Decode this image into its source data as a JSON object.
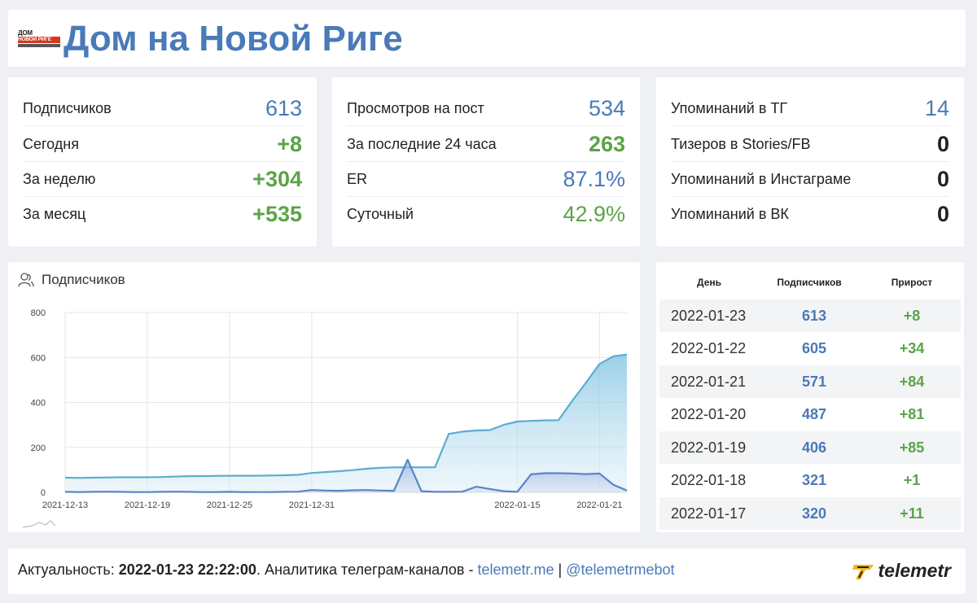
{
  "header": {
    "title": "Дом на Новой Риге",
    "logo_line1": "ДОМ",
    "logo_line2": "НОВОЙ РИГЕ"
  },
  "cards": {
    "subscribers": [
      {
        "label": "Подписчиков",
        "value": "613"
      },
      {
        "label": "Сегодня",
        "value": "+8"
      },
      {
        "label": "За неделю",
        "value": "+304"
      },
      {
        "label": "За месяц",
        "value": "+535"
      }
    ],
    "views": [
      {
        "label": "Просмотров на пост",
        "value": "534"
      },
      {
        "label": "За последние 24 часа",
        "value": "263"
      },
      {
        "label": "ER",
        "value": "87.1%"
      },
      {
        "label": "Суточный",
        "value": "42.9%"
      }
    ],
    "mentions": [
      {
        "label": "Упоминаний в ТГ",
        "value": "14"
      },
      {
        "label": "Тизеров в Stories/FB",
        "value": "0"
      },
      {
        "label": "Упоминаний в Инстаграме",
        "value": "0"
      },
      {
        "label": "Упоминаний в ВК",
        "value": "0"
      }
    ]
  },
  "chart_panel": {
    "title": "Подписчиков",
    "icon": "users-icon"
  },
  "chart_data": {
    "type": "area",
    "x": [
      "2021-12-13",
      "2021-12-14",
      "2021-12-15",
      "2021-12-16",
      "2021-12-17",
      "2021-12-18",
      "2021-12-19",
      "2021-12-20",
      "2021-12-21",
      "2021-12-22",
      "2021-12-23",
      "2021-12-24",
      "2021-12-25",
      "2021-12-26",
      "2021-12-27",
      "2021-12-28",
      "2021-12-29",
      "2021-12-30",
      "2021-12-31",
      "2022-01-01",
      "2022-01-02",
      "2022-01-03",
      "2022-01-04",
      "2022-01-05",
      "2022-01-06",
      "2022-01-07",
      "2022-01-08",
      "2022-01-09",
      "2022-01-10",
      "2022-01-11",
      "2022-01-12",
      "2022-01-13",
      "2022-01-14",
      "2022-01-15",
      "2022-01-16",
      "2022-01-17",
      "2022-01-18",
      "2022-01-19",
      "2022-01-20",
      "2022-01-21",
      "2022-01-22",
      "2022-01-23"
    ],
    "series": [
      {
        "values": [
          65,
          64,
          65,
          66,
          67,
          67,
          67,
          68,
          70,
          72,
          72,
          73,
          74,
          74,
          74,
          75,
          76,
          78,
          86,
          90,
          94,
          99,
          105,
          109,
          111,
          112,
          111,
          112,
          260,
          270,
          275,
          277,
          300,
          315,
          318,
          320,
          321,
          406,
          487,
          571,
          605,
          613
        ],
        "color": "#5aaed0"
      },
      {
        "values": [
          2,
          1,
          2,
          3,
          2,
          1,
          1,
          2,
          3,
          2,
          1,
          1,
          2,
          1,
          1,
          1,
          2,
          3,
          10,
          8,
          7,
          9,
          10,
          8,
          7,
          145,
          5,
          2,
          2,
          3,
          25,
          15,
          5,
          2,
          80,
          85,
          85,
          84,
          81,
          84,
          34,
          8
        ],
        "color": "#5a84c8"
      }
    ],
    "xticks": [
      "2021-12-13",
      "2021-12-19",
      "2021-12-25",
      "2021-12-31",
      "2022-01-15",
      "2022-01-21"
    ],
    "yticks": [
      0,
      200,
      400,
      600,
      800
    ],
    "ylim": [
      0,
      800
    ],
    "grid": true
  },
  "table": {
    "headers": {
      "date": "День",
      "subs": "Подписчиков",
      "growth": "Прирост"
    },
    "rows": [
      {
        "date": "2022-01-23",
        "subs": "613",
        "growth": "+8"
      },
      {
        "date": "2022-01-22",
        "subs": "605",
        "growth": "+34"
      },
      {
        "date": "2022-01-21",
        "subs": "571",
        "growth": "+84"
      },
      {
        "date": "2022-01-20",
        "subs": "487",
        "growth": "+81"
      },
      {
        "date": "2022-01-19",
        "subs": "406",
        "growth": "+85"
      },
      {
        "date": "2022-01-18",
        "subs": "321",
        "growth": "+1"
      },
      {
        "date": "2022-01-17",
        "subs": "320",
        "growth": "+11"
      }
    ]
  },
  "footer": {
    "prefix": "Актуальность: ",
    "timestamp": "2022-01-23 22:22:00",
    "middle": ". Аналитика телеграм-каналов - ",
    "link1": "telemetr.me",
    "separator": " | ",
    "link2": "@telemetrmebot",
    "brand": "telemetr"
  },
  "colors": {
    "accent_blue": "#4a7ab8",
    "accent_green": "#5aa447"
  }
}
